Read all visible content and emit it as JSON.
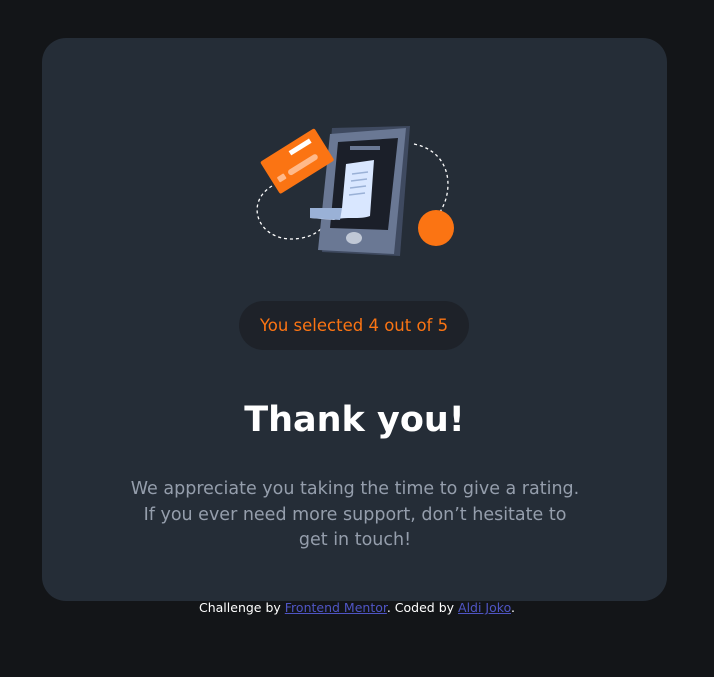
{
  "card": {
    "badge_text": "You selected 4 out of 5",
    "title": "Thank you!",
    "message_line1": "We appreciate you taking the time to give a rating.",
    "message_line2": "If you ever need more support, don’t hesitate to",
    "message_line3": "get in touch!"
  },
  "illustration": {
    "icon": "phone-payment-receipt-illustration"
  },
  "footer": {
    "prefix": "Challenge by ",
    "challenge_link": "Frontend Mentor",
    "middle": ". Coded by ",
    "author_link": "Aldi Joko",
    "suffix": "."
  },
  "colors": {
    "page_background": "#131518",
    "card_background": "#252d37",
    "accent_orange": "#fb7413",
    "badge_background": "#1e2229",
    "text_gray": "#959eac",
    "link_color": "#4f55c4"
  }
}
